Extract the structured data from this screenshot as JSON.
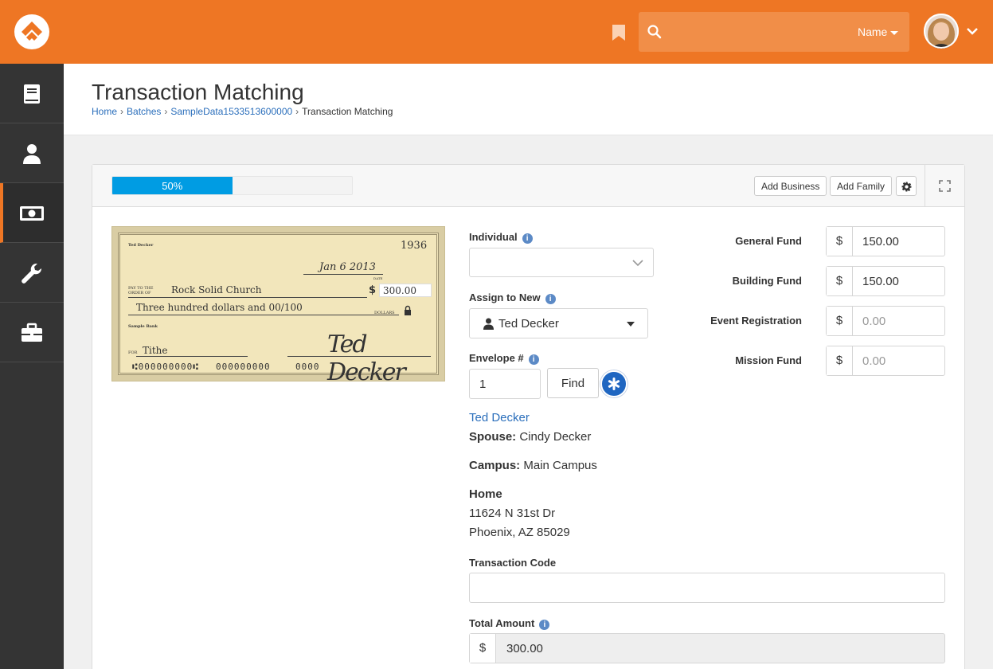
{
  "header": {
    "search_placeholder": "",
    "search_filter": "Name"
  },
  "page": {
    "title": "Transaction Matching",
    "breadcrumb": [
      "Home",
      "Batches",
      "SampleData1533513600000",
      "Transaction Matching"
    ]
  },
  "toolbar": {
    "progress_percent": 50,
    "progress_label": "50%",
    "add_business": "Add Business",
    "add_family": "Add Family"
  },
  "check": {
    "owner": "Ted Decker",
    "number": "1936",
    "date": "Jan 6 2013",
    "date_label": "DATE",
    "pay_to_label": "PAY TO THE ORDER OF",
    "payee": "Rock Solid Church",
    "amount": "300.00",
    "amount_words": "Three hundred dollars and 00/100",
    "dollars_label": "DOLLARS",
    "bank": "Sample Bank",
    "for_label": "FOR",
    "memo": "Tithe",
    "signature": "Ted Decker",
    "micr_routing": "⑆000000000⑆",
    "micr_account": "000000000",
    "micr_number": "0000"
  },
  "form": {
    "individual_label": "Individual",
    "individual_value": "",
    "assign_label": "Assign to New",
    "assign_value": "Ted Decker",
    "envelope_label": "Envelope #",
    "envelope_value": "1",
    "find_label": "Find",
    "person_name": "Ted Decker",
    "spouse_label": "Spouse:",
    "spouse_value": "Cindy Decker",
    "campus_label": "Campus:",
    "campus_value": "Main Campus",
    "address_label": "Home",
    "address_line1": "11624 N 31st Dr",
    "address_line2": "Phoenix, AZ 85029",
    "transaction_code_label": "Transaction Code",
    "transaction_code_value": "",
    "total_label": "Total Amount",
    "total_value": "300.00",
    "currency": "$"
  },
  "funds": [
    {
      "label": "General Fund",
      "value": "150.00",
      "placeholder": ""
    },
    {
      "label": "Building Fund",
      "value": "150.00",
      "placeholder": ""
    },
    {
      "label": "Event Registration",
      "value": "",
      "placeholder": "0.00"
    },
    {
      "label": "Mission Fund",
      "value": "",
      "placeholder": "0.00"
    }
  ],
  "colors": {
    "brand": "#ee7624",
    "sidebar": "#343434",
    "progress": "#009ce3",
    "link": "#2a6ebb",
    "primary_button": "#1f66c1"
  },
  "icons": {
    "sidebar": [
      "book-icon",
      "user-icon",
      "money-icon",
      "wrench-icon",
      "briefcase-icon"
    ],
    "header": [
      "rock-logo-icon",
      "bookmark-icon",
      "search-icon",
      "chevron-down-icon"
    ]
  }
}
